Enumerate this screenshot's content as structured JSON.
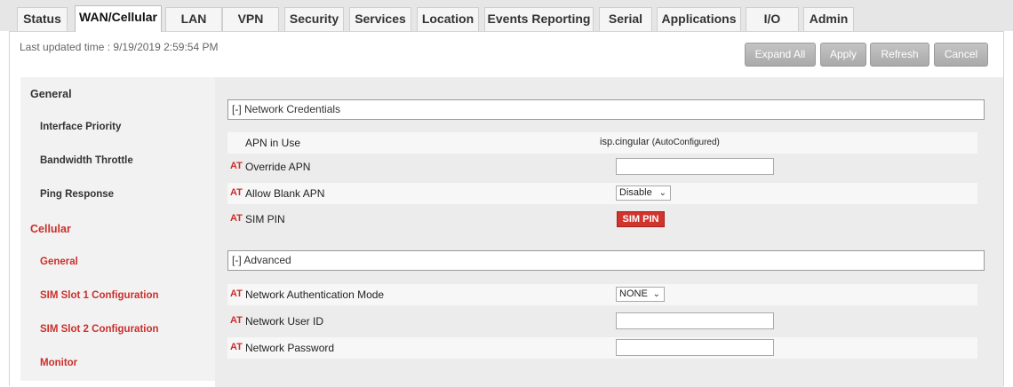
{
  "tabs": [
    {
      "label": "Status"
    },
    {
      "label": "WAN/Cellular"
    },
    {
      "label": "LAN"
    },
    {
      "label": "VPN"
    },
    {
      "label": "Security"
    },
    {
      "label": "Services"
    },
    {
      "label": "Location"
    },
    {
      "label": "Events Reporting"
    },
    {
      "label": "Serial"
    },
    {
      "label": "Applications"
    },
    {
      "label": "I/O"
    },
    {
      "label": "Admin"
    }
  ],
  "active_tab": "WAN/Cellular",
  "last_updated": "Last updated time : 9/19/2019 2:59:54 PM",
  "toolbar": {
    "expand_all": "Expand All",
    "apply": "Apply",
    "refresh": "Refresh",
    "cancel": "Cancel"
  },
  "sidebar": {
    "items": [
      {
        "label": "General"
      },
      {
        "label": "Interface Priority"
      },
      {
        "label": "Bandwidth Throttle"
      },
      {
        "label": "Ping Response"
      },
      {
        "label": "Cellular"
      },
      {
        "label": "General"
      },
      {
        "label": "SIM Slot 1 Configuration"
      },
      {
        "label": "SIM Slot 2 Configuration"
      },
      {
        "label": "Monitor"
      }
    ]
  },
  "sections": {
    "network_credentials": {
      "header": "[-] Network Credentials",
      "apn_in_use": {
        "label": "APN in Use",
        "value": "isp.cingular",
        "note": "(AutoConfigured)"
      },
      "override_apn": {
        "at": "AT",
        "label": "Override APN",
        "value": ""
      },
      "allow_blank_apn": {
        "at": "AT",
        "label": "Allow Blank APN",
        "value": "Disable"
      },
      "sim_pin": {
        "at": "AT",
        "label": "SIM PIN",
        "button": "SIM PIN"
      }
    },
    "advanced": {
      "header": "[-] Advanced",
      "auth_mode": {
        "at": "AT",
        "label": "Network Authentication Mode",
        "value": "NONE"
      },
      "user_id": {
        "at": "AT",
        "label": "Network User ID",
        "value": ""
      },
      "password": {
        "at": "AT",
        "label": "Network Password",
        "value": ""
      }
    }
  },
  "icons": {
    "dropdown": "chevron-down-icon"
  },
  "colors": {
    "accent_red": "#c9302c",
    "button_gray": "#b5b5b5",
    "content_bg": "#ececec"
  }
}
